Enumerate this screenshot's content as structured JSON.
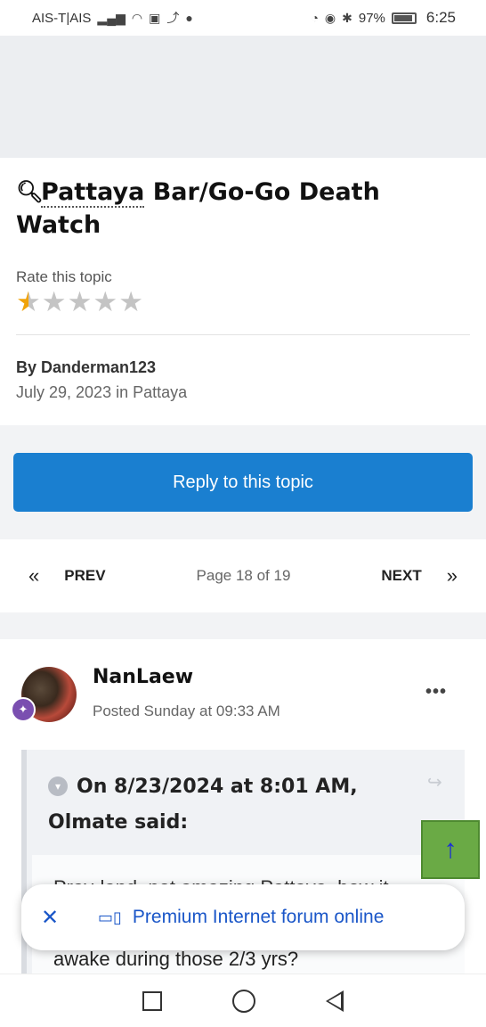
{
  "status_bar": {
    "carrier": "AIS-T|AIS",
    "battery": "97%",
    "time": "6:25"
  },
  "topic": {
    "title_part1": "Pattaya",
    "title_part2": " Bar/Go-Go Death Watch",
    "rate_label": "Rate this topic",
    "rating": 1,
    "rating_max": 5,
    "author": "By Danderman123",
    "date_forum": "July 29, 2023 in Pattaya"
  },
  "reply_button": "Reply to this topic",
  "pagination": {
    "prev_label": "PREV",
    "next_label": "NEXT",
    "page_info": "Page 18 of 19"
  },
  "post": {
    "username": "NanLaew",
    "posted": "Posted Sunday at 09:33 AM",
    "more_label": "•••",
    "quote_header": "On 8/23/2024 at 8:01 AM, Olmate said:",
    "quote_line_partial": "Pray-land, not amazing Pattaya, how it",
    "post_line": "awake during those 2/3 yrs?"
  },
  "banner_pill": {
    "text": "Premium Internet forum online"
  },
  "colors": {
    "accent_blue": "#1a7fd0",
    "star_active": "#f0a30a",
    "scroll_button": "#6aaa45"
  }
}
